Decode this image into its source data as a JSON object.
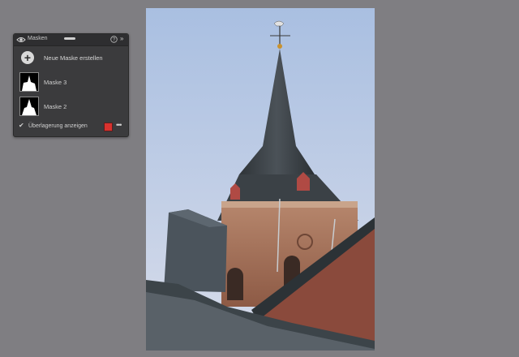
{
  "panel": {
    "title": "Masken",
    "add_mask_label": "Neue Maske erstellen",
    "masks": [
      {
        "label": "Maske 3"
      },
      {
        "label": "Maske 2"
      }
    ],
    "overlay_label": "Überlagerung anzeigen",
    "overlay_checked": true,
    "overlay_color": "#d9322e",
    "icons": [
      "eye-icon",
      "help-icon",
      "collapse-icon",
      "plus-icon",
      "checkmark-icon",
      "more-icon"
    ]
  },
  "image": {
    "description_icon": "church-tower-photo"
  }
}
